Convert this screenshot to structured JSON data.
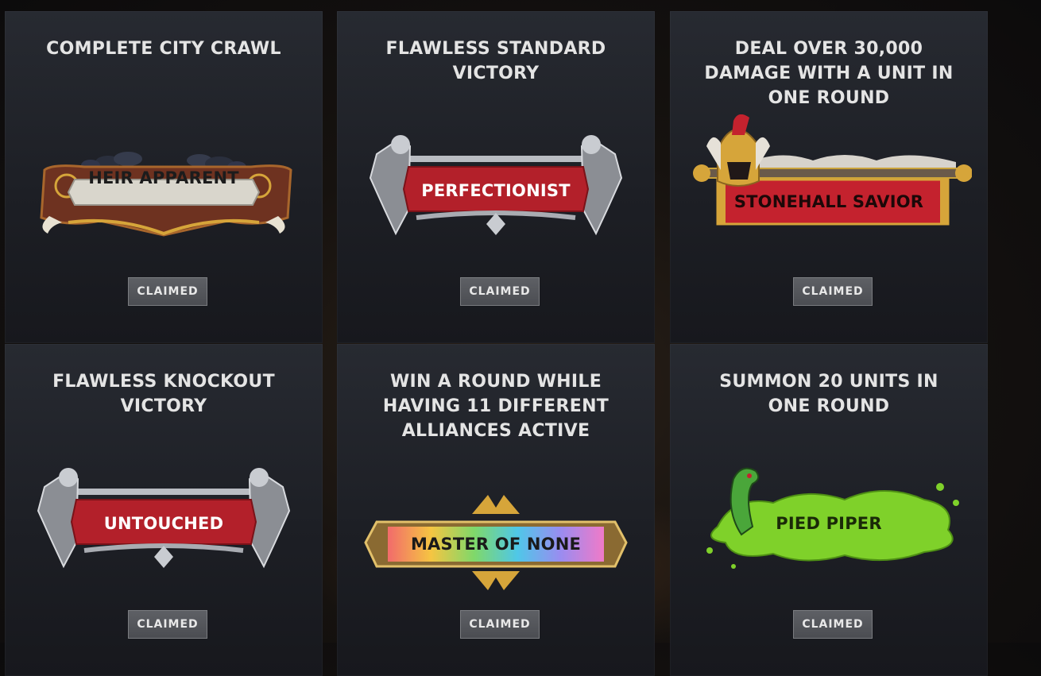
{
  "achievements": [
    {
      "title": "COMPLETE CITY CRAWL",
      "badge": "HEIR APPARENT",
      "status": "CLAIMED",
      "badge_style": "bronze-scroll"
    },
    {
      "title": "FLAWLESS STANDARD VICTORY",
      "badge": "PERFECTIONIST",
      "status": "CLAIMED",
      "badge_style": "silver-knights-red"
    },
    {
      "title": "DEAL OVER 30,000 DAMAGE WITH A UNIT IN ONE ROUND",
      "badge": "STONEHALL SAVIOR",
      "status": "CLAIMED",
      "badge_style": "golden-helmet-red-banner"
    },
    {
      "title": "FLAWLESS KNOCKOUT VICTORY",
      "badge": "UNTOUCHED",
      "status": "CLAIMED",
      "badge_style": "silver-knights-red"
    },
    {
      "title": "WIN A ROUND WHILE HAVING 11 DIFFERENT ALLIANCES ACTIVE",
      "badge": "MASTER OF NONE",
      "status": "CLAIMED",
      "badge_style": "rainbow-gold"
    },
    {
      "title": "SUMMON 20 UNITS IN ONE ROUND",
      "badge": "PIED PIPER",
      "status": "CLAIMED",
      "badge_style": "green-splatter-serpent"
    }
  ],
  "colors": {
    "card_bg": "#23262c",
    "title_text": "#e4e4e4",
    "claimed_bg": "#56585d",
    "red_banner": "#b3202a",
    "green_splat": "#7fd12a",
    "gold": "#d6a53a"
  }
}
